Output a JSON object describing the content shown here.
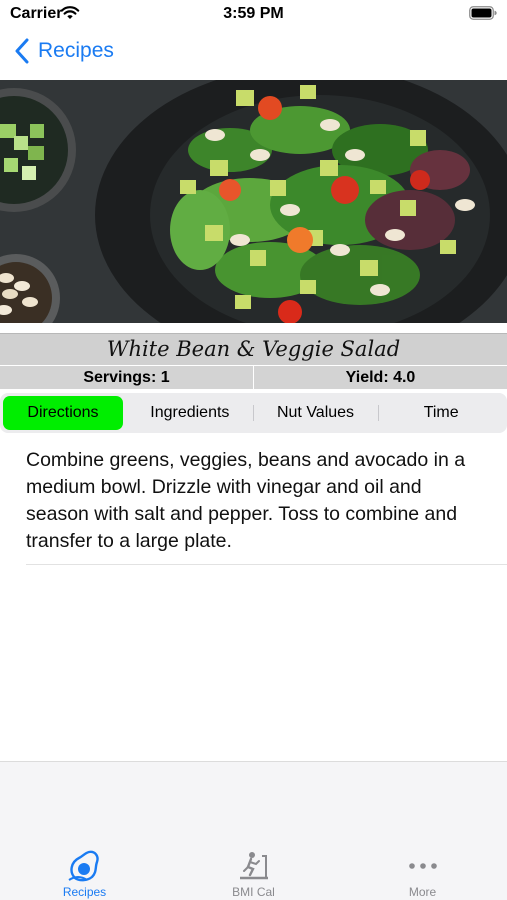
{
  "status_bar": {
    "carrier": "Carrier",
    "time": "3:59 PM"
  },
  "nav": {
    "back_label": "Recipes"
  },
  "recipe": {
    "title": "White Bean & Veggie Salad",
    "servings": "Servings: 1",
    "yield": "Yield: 4.0"
  },
  "tabs": {
    "selected": "Directions",
    "items": [
      "Directions",
      "Ingredients",
      "Nut Values",
      "Time"
    ]
  },
  "directions": "Combine greens, veggies, beans and avocado in a medium bowl. Drizzle with vinegar and oil and season with salt and pepper. Toss to combine and transfer to a large plate.",
  "tab_bar": {
    "items": [
      {
        "label": "Recipes",
        "icon": "avocado-icon",
        "active": true
      },
      {
        "label": "BMI Cal",
        "icon": "treadmill-icon",
        "active": false
      },
      {
        "label": "More",
        "icon": "more-dots-icon",
        "active": false
      }
    ]
  },
  "colors": {
    "accent": "#1a7bf2",
    "selected_segment": "#00ee00",
    "tab_inactive": "#8a8a8e"
  }
}
